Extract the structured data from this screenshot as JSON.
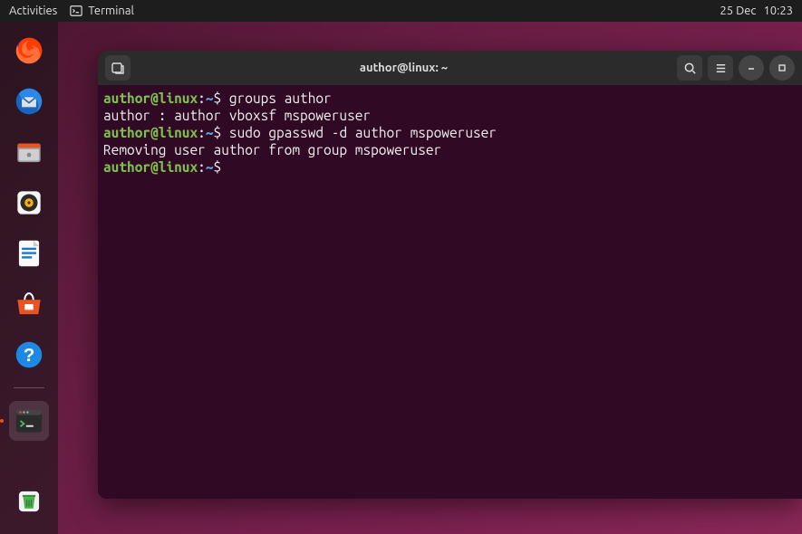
{
  "topbar": {
    "activities": "Activities",
    "app_label": "Terminal",
    "date": "25 Dec",
    "time": "10:23"
  },
  "dock": {
    "items": [
      {
        "name": "firefox"
      },
      {
        "name": "thunderbird"
      },
      {
        "name": "files"
      },
      {
        "name": "rhythmbox"
      },
      {
        "name": "libreoffice-writer"
      },
      {
        "name": "ubuntu-software"
      },
      {
        "name": "help"
      }
    ],
    "active": {
      "name": "terminal"
    },
    "trash": {
      "name": "trash"
    }
  },
  "terminal": {
    "title": "author@linux: ~",
    "prompt": {
      "userhost": "author@linux",
      "path": "~",
      "symbol": "$"
    },
    "lines": [
      {
        "type": "prompt",
        "command": "groups author"
      },
      {
        "type": "output",
        "text": "author : author vboxsf mspoweruser"
      },
      {
        "type": "prompt",
        "command": "sudo gpasswd -d author mspoweruser"
      },
      {
        "type": "output",
        "text": "Removing user author from group mspoweruser"
      },
      {
        "type": "prompt",
        "command": ""
      }
    ]
  }
}
